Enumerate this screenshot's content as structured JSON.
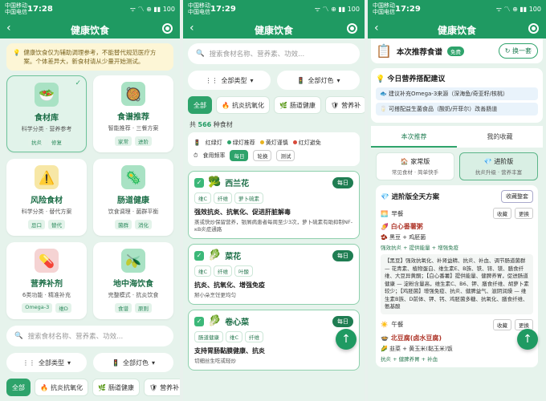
{
  "status": {
    "carrier1": "中国移动",
    "carrier2": "中国电信",
    "icons": "ᯤ 〽 ⊕ ▮▮ 100"
  },
  "p1": {
    "time": "17:28",
    "title": "健康饮食",
    "notice": "健康饮食仅为辅助调理参考，不能替代规范医疗方案。个体差异大，新食材请从少量开始测试。",
    "cards": [
      {
        "icon": "🥗",
        "title": "食材库",
        "sub": "科学分类 · 营养参考",
        "tags": [
          "抗炎",
          "修复"
        ]
      },
      {
        "icon": "🥘",
        "title": "食谱推荐",
        "sub": "智能推荐 · 三餐方案",
        "tags": [
          "家常",
          "进阶"
        ]
      },
      {
        "icon": "⚠️",
        "title": "风险食材",
        "sub": "科学分类 · 替代方案",
        "tags": [
          "忌口",
          "替代"
        ]
      },
      {
        "icon": "🦠",
        "title": "肠道健康",
        "sub": "饮食调理 · 菌群平衡",
        "tags": [
          "菌群",
          "消化"
        ]
      },
      {
        "icon": "💊",
        "title": "营养补剂",
        "sub": "6类功能 · 精准补充",
        "tags": [
          "Omega-3",
          "维D"
        ]
      },
      {
        "icon": "🫒",
        "title": "地中海饮食",
        "sub": "完整模式 · 抗炎饮食",
        "tags": [
          "食谱",
          "原则"
        ]
      }
    ],
    "search_placeholder": "搜索食材名称、营养素、功效...",
    "filter_type": "全部类型",
    "filter_light": "全部灯色",
    "chips": [
      "全部",
      "抗炎抗氧化",
      "肠道健康",
      "营养补"
    ]
  },
  "p2": {
    "time": "17:29",
    "title": "健康饮食",
    "search_placeholder": "搜索食材名称、营养素、功效...",
    "filter_type": "全部类型",
    "filter_light": "全部灯色",
    "chips": [
      "全部",
      "抗炎抗氧化",
      "肠道健康",
      "营养补"
    ],
    "count_prefix": "共 ",
    "count_value": "566",
    "count_suffix": " 种食材",
    "legend_title": "红绿灯",
    "legend_items": [
      "绿灯推荐",
      "黄灯谨慎",
      "红灯避免"
    ],
    "freq_label": "食用频率",
    "freq_items": [
      "每日",
      "轮换",
      "测试"
    ],
    "foods": [
      {
        "emoji": "🥦",
        "name": "西兰花",
        "badge": "每日",
        "tags": [
          "维C",
          "纤维",
          "萝卜硫素"
        ],
        "desc": "强效抗炎、抗氧化、促进肝脏解毒",
        "tip": "蒸或快炒保留营养，银屑病患者每周至少3次，萝卜硫素有助抑制NF-κB炎症通路"
      },
      {
        "emoji": "🥬",
        "name": "菜花",
        "badge": "每日",
        "tags": [
          "维C",
          "纤维",
          "叶酸"
        ],
        "desc": "抗炎、抗氧化、增强免疫",
        "tip": "掰小朵烹饪更均匀"
      },
      {
        "emoji": "🥬",
        "name": "卷心菜",
        "badge": "每日",
        "tags": [
          "肠道健康",
          "维C",
          "纤维"
        ],
        "desc": "支持胃肠黏膜健康、抗炎",
        "tip": "切细丝生吃或轻炒"
      }
    ]
  },
  "p3": {
    "time": "17:29",
    "title": "健康饮食",
    "head_title": "本次推荐食谱",
    "free_badge": "免费",
    "swap": "换一套",
    "advice_title": "今日营养搭配建议",
    "advice_items": [
      "建议补充Omega-3来源（深海鱼/奇亚籽/核桃）",
      "可搭配益生菌食品（酸奶/开菲尔）改善肠道"
    ],
    "tabs": [
      "本次推荐",
      "我的收藏"
    ],
    "versions": [
      {
        "icon": "🏠",
        "title": "家常版",
        "sub": "常见食材 · 简单快手"
      },
      {
        "icon": "💎",
        "title": "进阶版",
        "sub": "抗炎升级 · 营养丰富"
      }
    ],
    "plan_title": "进阶版全天方案",
    "plan_btn": "收藏整套",
    "meals": [
      {
        "icon": "🌅",
        "label": "早餐",
        "btns": [
          "收藏",
          "更换"
        ],
        "dish": "白心番薯粥",
        "ing": "黑豆 + 鸡胚菌",
        "ben": "强效抗炎 + 提供能量 + 增强免疫",
        "detail": "【黑豆】强效抗氧化、补肾益精、抗炎、补血、调节肠道菌群 — 花青素、植物蛋白、维生素E、B族、铁、锌、镁、膳食纤维、大豆异黄酮；【白心番薯】提供能量、健脾养胃，促进肠道健康 — 淀粉含量高，维生素C、B6、钾、膳食纤维、胡萝卜素较少；【鸡胚菌】增强免疫、抗炎、健脾益气、滋阴润燥 — 维生素B族、D前体、钾、钙、鸡胚菌多糖、抗氧化、膳食纤维、氨基酸"
      },
      {
        "icon": "☀️",
        "label": "午餐",
        "btns": [
          "收藏",
          "更换"
        ],
        "dish": "北豆腐(卤水豆腐)",
        "ing": "韭菜 + 黄玉米(黏玉米)饭",
        "ben": "抗炎 + 健脾养胃 + 补血",
        "detail": ""
      }
    ]
  }
}
